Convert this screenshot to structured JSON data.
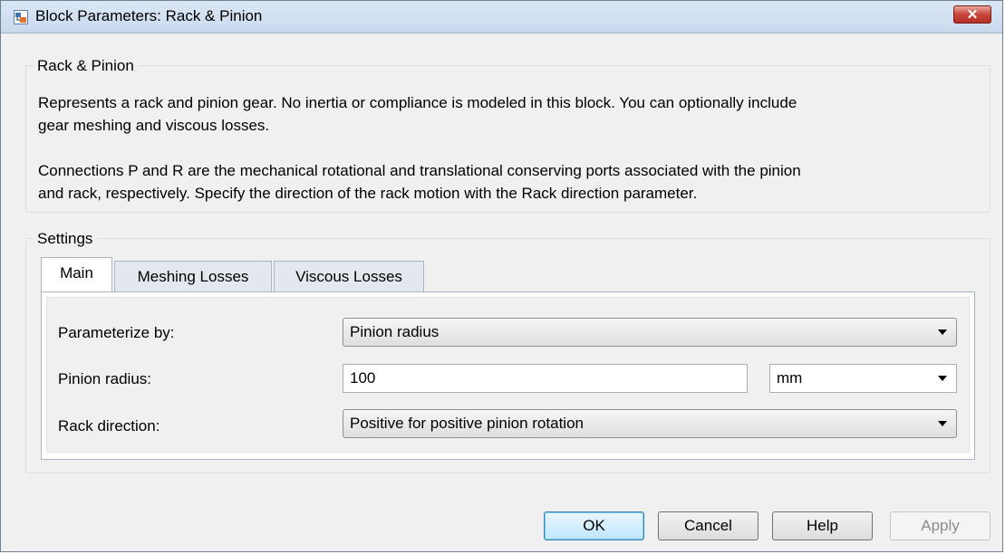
{
  "window": {
    "title": "Block Parameters: Rack & Pinion",
    "close_glyph": "✕",
    "icon": "simulink-block-icon"
  },
  "description_group": {
    "label": "Rack & Pinion",
    "paragraph1_line1": "Represents a rack and pinion gear. No inertia or compliance is modeled in this block. You can optionally include",
    "paragraph1_line2": "gear meshing and viscous losses.",
    "paragraph2_line1": "Connections P and R are the mechanical rotational and translational conserving ports associated with the pinion",
    "paragraph2_line2": "and rack, respectively. Specify the direction of the rack motion with the Rack direction parameter."
  },
  "settings_group": {
    "label": "Settings",
    "tabs": [
      {
        "label": "Main",
        "active": true
      },
      {
        "label": "Meshing Losses",
        "active": false
      },
      {
        "label": "Viscous Losses",
        "active": false
      }
    ],
    "fields": {
      "parameterize_by": {
        "label": "Parameterize by:",
        "value": "Pinion radius"
      },
      "pinion_radius": {
        "label": "Pinion radius:",
        "value": "100",
        "unit": "mm"
      },
      "rack_direction": {
        "label": "Rack direction:",
        "value": "Positive for positive pinion rotation"
      }
    }
  },
  "buttons": {
    "ok": "OK",
    "cancel": "Cancel",
    "help": "Help",
    "apply": "Apply"
  },
  "colors": {
    "close_button": "#c9443a",
    "default_button": "#bee6fd"
  }
}
